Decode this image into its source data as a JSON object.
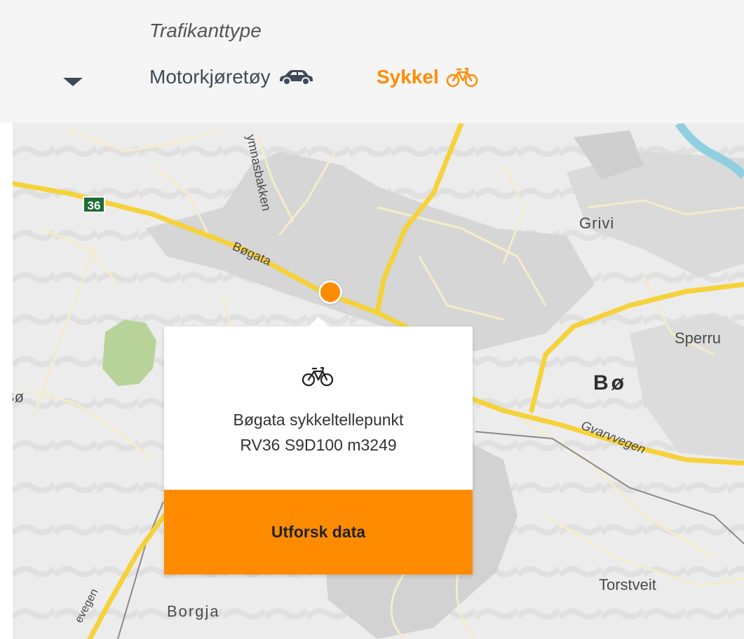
{
  "filter": {
    "title": "Trafikanttype",
    "options": [
      {
        "label": "Motorkjøretøy",
        "icon": "car-icon",
        "selected": false
      },
      {
        "label": "Sykkel",
        "icon": "bicycle-icon",
        "selected": true
      }
    ],
    "caret_icon": "caret-down-icon"
  },
  "colors": {
    "accent": "#ff8c00",
    "text_dark": "#3f4a56",
    "road_major": "#f5d23a",
    "route_shield": "#1f6b35"
  },
  "map": {
    "route_shield": "36",
    "labels": {
      "grivi": "Grivi",
      "sperru": "Sperru",
      "bo_town": "Bø",
      "bo_left": "Bø",
      "bogata": "Bøgata",
      "gymnasbakken": "ymnasbakken",
      "gvarvvegen": "Gvarvvegen",
      "torstveit": "Torstveit",
      "borgja": "Borgja",
      "vegen_left": "evegen"
    },
    "selected_point": {
      "icon": "map-marker"
    }
  },
  "popup": {
    "icon": "bicycle-icon",
    "name": "Bøgata sykkeltellepunkt",
    "reference": "RV36 S9D100 m3249",
    "button_label": "Utforsk data"
  }
}
